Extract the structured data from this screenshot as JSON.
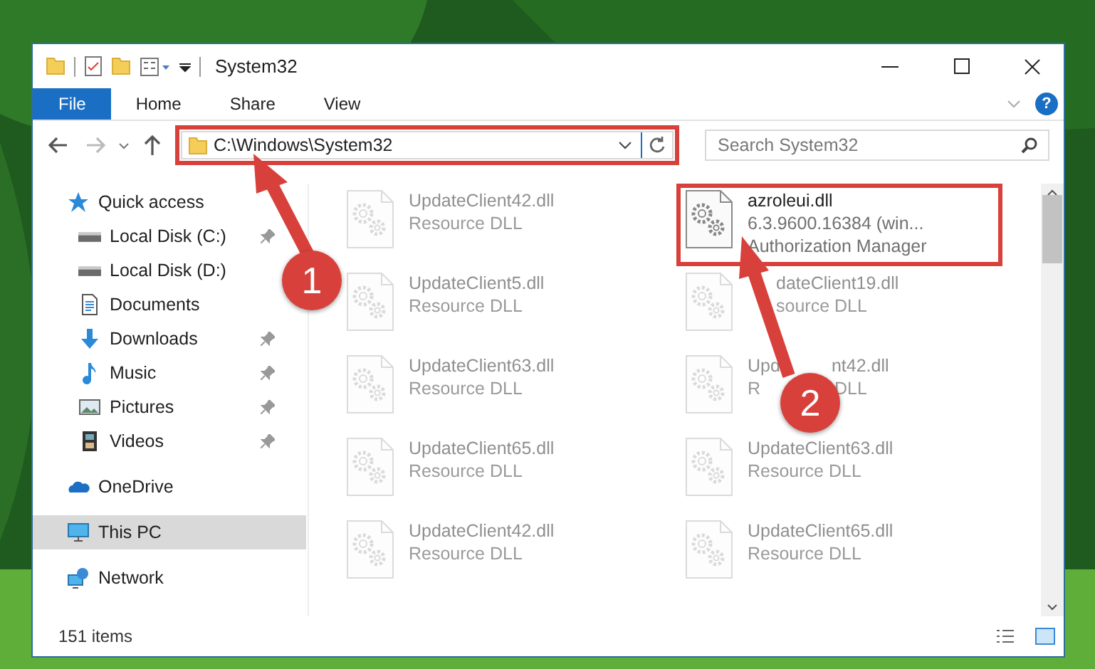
{
  "window": {
    "title": "System32"
  },
  "ribbon": {
    "tabs": [
      {
        "label": "File",
        "selected": true
      },
      {
        "label": "Home",
        "selected": false
      },
      {
        "label": "Share",
        "selected": false
      },
      {
        "label": "View",
        "selected": false
      }
    ],
    "help": "?"
  },
  "nav_buttons": {
    "back_disabled": false,
    "forward_disabled": true
  },
  "address_bar": {
    "path": "C:\\Windows\\System32",
    "highlighted": true
  },
  "search": {
    "placeholder": "Search System32"
  },
  "navigation": [
    {
      "label": "Quick access",
      "kind": "star",
      "selected": false,
      "children": [
        {
          "label": "Local Disk (C:)",
          "kind": "drive",
          "pinned": true,
          "selected": false
        },
        {
          "label": "Local Disk (D:)",
          "kind": "drive",
          "pinned": false,
          "selected": false
        },
        {
          "label": "Documents",
          "kind": "document",
          "pinned": false,
          "selected": false
        },
        {
          "label": "Downloads",
          "kind": "download",
          "pinned": true,
          "selected": false
        },
        {
          "label": "Music",
          "kind": "music",
          "pinned": true,
          "selected": false
        },
        {
          "label": "Pictures",
          "kind": "pictures",
          "pinned": true,
          "selected": false
        },
        {
          "label": "Videos",
          "kind": "videos",
          "pinned": true,
          "selected": false
        }
      ]
    },
    {
      "label": "OneDrive",
      "kind": "cloud",
      "selected": false
    },
    {
      "label": "This PC",
      "kind": "computer",
      "selected": true
    },
    {
      "label": "Network",
      "kind": "network",
      "selected": false
    }
  ],
  "files": [
    {
      "name": [
        "UpdateClient42.dll"
      ],
      "details": [
        [
          "Resource DLL"
        ]
      ],
      "dimmed": true,
      "highlighted": false,
      "kind": "whole"
    },
    {
      "name": [
        "azroleui.dll"
      ],
      "details": [
        [
          "6.3.9600.16384 (win..."
        ],
        [
          "Authorization Manager"
        ]
      ],
      "dimmed": false,
      "highlighted": true,
      "kind": "whole"
    },
    {
      "name": [
        "UpdateClient5.dll"
      ],
      "details": [
        [
          "Resource DLL"
        ]
      ],
      "dimmed": true,
      "highlighted": false,
      "kind": "whole"
    },
    {
      "name": [
        "dateClient19.dll"
      ],
      "details": [
        [
          "source DLL"
        ]
      ],
      "dimmed": true,
      "highlighted": false,
      "kind": "cut_start"
    },
    {
      "name": [
        "UpdateClient63.dll"
      ],
      "details": [
        [
          "Resource DLL"
        ]
      ],
      "dimmed": true,
      "highlighted": false,
      "kind": "whole"
    },
    {
      "name": [
        "Upd",
        "nt42.dll"
      ],
      "details": [
        [
          "R",
          "DLL"
        ]
      ],
      "dimmed": true,
      "highlighted": false,
      "kind": "cut_middle"
    },
    {
      "name": [
        "UpdateClient65.dll"
      ],
      "details": [
        [
          "Resource DLL"
        ]
      ],
      "dimmed": true,
      "highlighted": false,
      "kind": "whole"
    },
    {
      "name": [
        "UpdateClient63.dll"
      ],
      "details": [
        [
          "Resource DLL"
        ]
      ],
      "dimmed": true,
      "highlighted": false,
      "kind": "whole"
    },
    {
      "name": [
        "UpdateClient42.dll"
      ],
      "details": [
        [
          "Resource DLL"
        ]
      ],
      "dimmed": true,
      "highlighted": false,
      "kind": "whole"
    },
    {
      "name": [
        "UpdateClient65.dll"
      ],
      "details": [
        [
          "Resource DLL"
        ]
      ],
      "dimmed": true,
      "highlighted": false,
      "kind": "whole"
    }
  ],
  "status_bar": {
    "count": "151 items"
  },
  "annotations": [
    {
      "label": "1"
    },
    {
      "label": "2"
    }
  ]
}
